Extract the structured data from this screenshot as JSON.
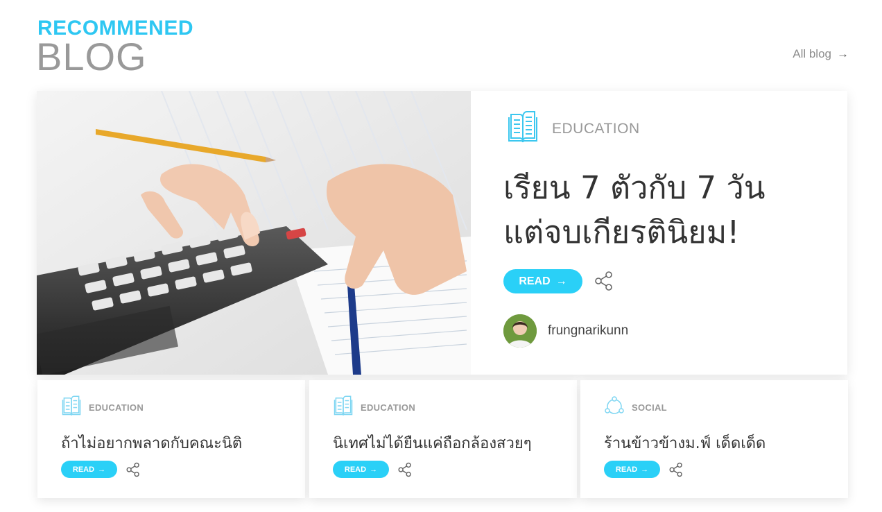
{
  "header": {
    "subtitle": "RECOMMENED",
    "title": "BLOG",
    "all_blog_label": "All blog",
    "all_blog_arrow": "→"
  },
  "featured": {
    "category": "EDUCATION",
    "category_icon": "open-book-icon",
    "title_line1": "เรียน 7 ตัวกับ 7 วัน",
    "title_line2": "แต่จบเกียรตินิยม!",
    "read_label": "READ",
    "read_arrow": "→",
    "author": "frungnarikunn"
  },
  "cards": [
    {
      "category": "EDUCATION",
      "category_icon": "open-book-icon",
      "title": "ถ้าไม่อยากพลาดกับคณะนิติ",
      "read_label": "READ",
      "read_arrow": "→"
    },
    {
      "category": "EDUCATION",
      "category_icon": "open-book-icon",
      "title": "นิเทศไม่ได้ยืนแค่ถือกล้องสวยๆ",
      "read_label": "READ",
      "read_arrow": "→"
    },
    {
      "category": "SOCIAL",
      "category_icon": "social-network-icon",
      "title": "ร้านข้าวข้างม.ฟ์ เด็ดเด็ด",
      "read_label": "READ",
      "read_arrow": "→"
    }
  ],
  "colors": {
    "accent": "#2ec7f2",
    "button": "#2ad0f7",
    "heading_gray": "#999999",
    "text_dark": "#333333"
  }
}
